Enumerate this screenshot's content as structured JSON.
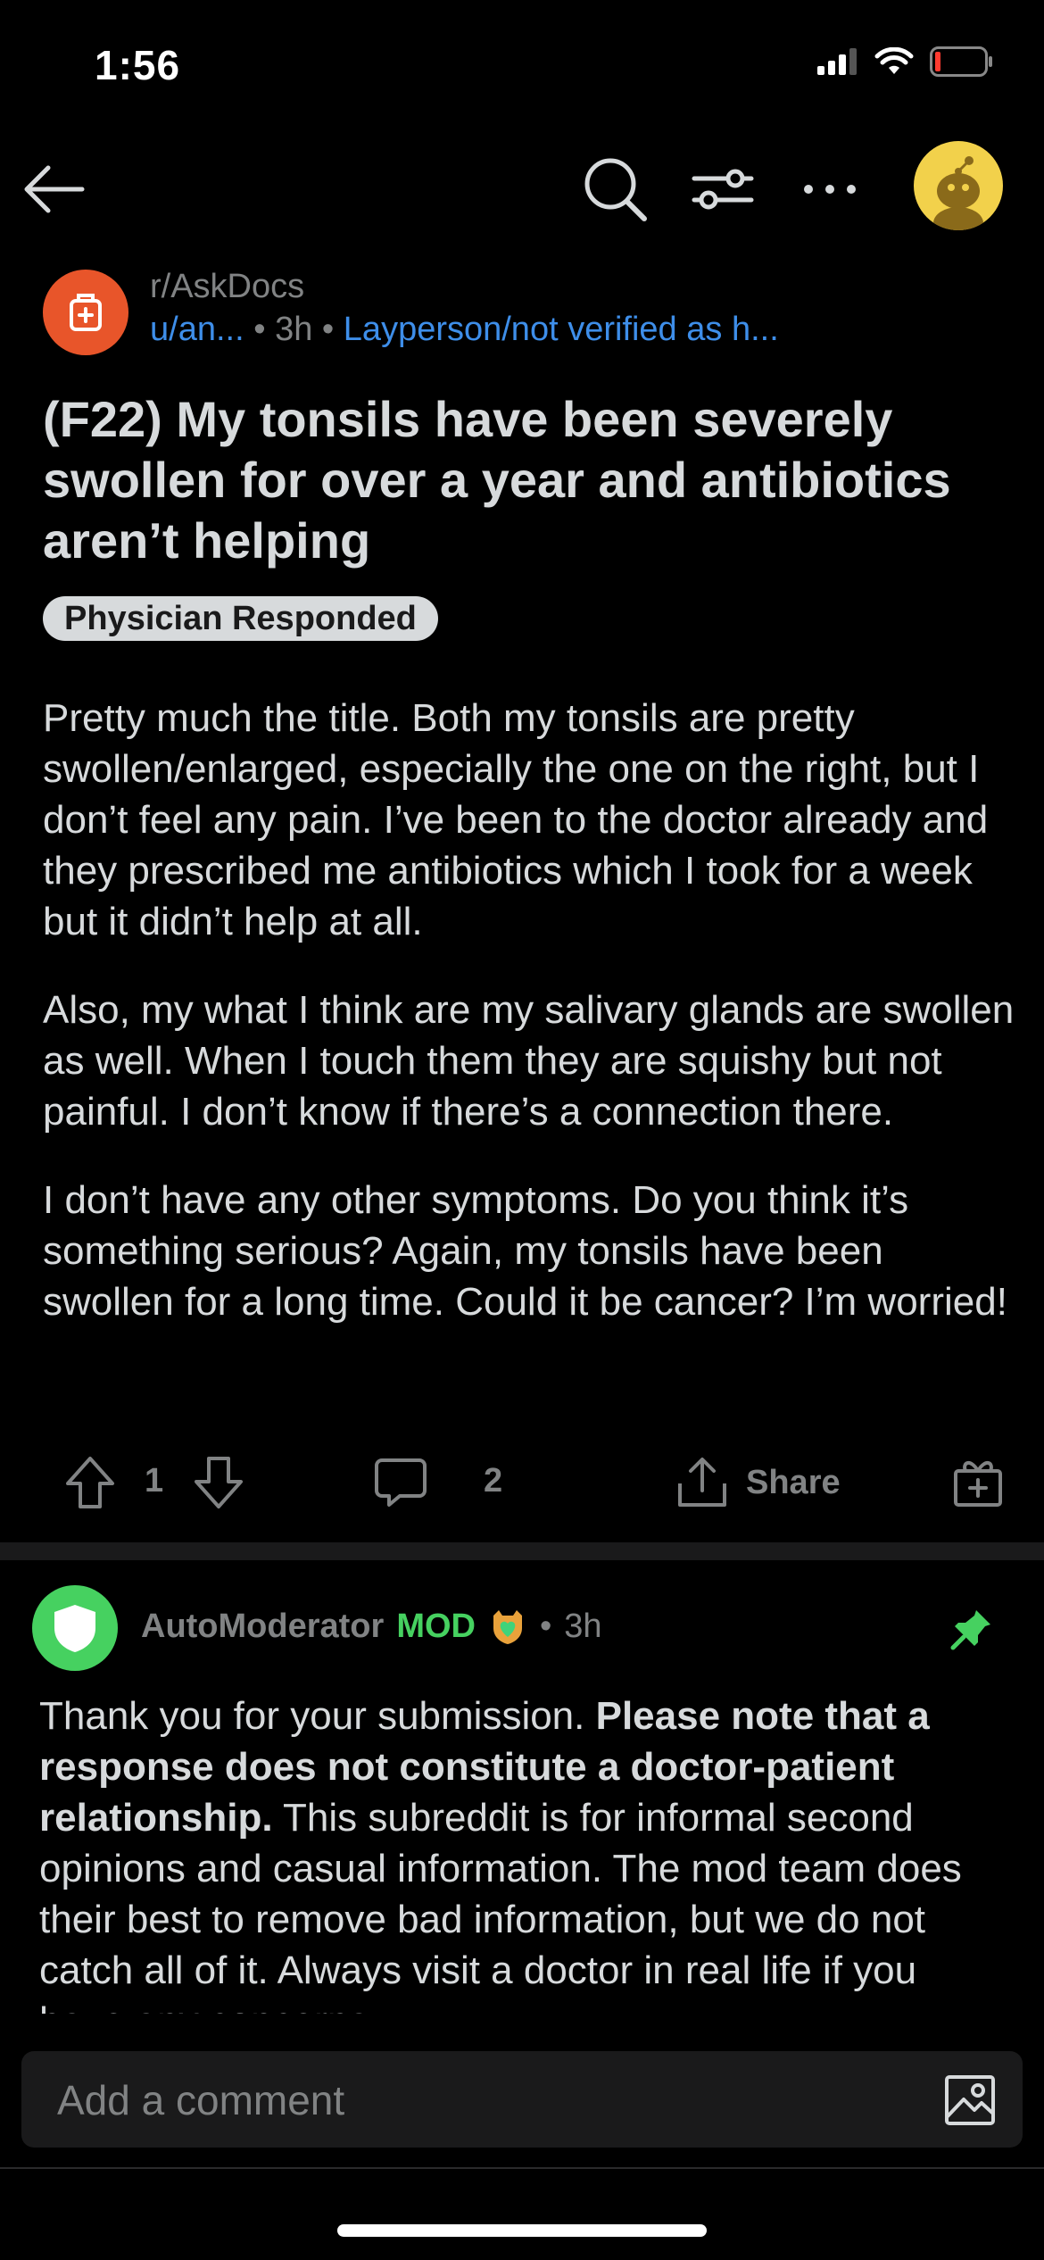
{
  "status_bar": {
    "time": "1:56",
    "icons": [
      "signal-icon",
      "wifi-icon",
      "battery-icon"
    ]
  },
  "nav": {
    "icons": [
      "back-arrow-icon",
      "search-icon",
      "filter-icon",
      "more-icon",
      "avatar"
    ]
  },
  "post": {
    "subreddit": "r/AskDocs",
    "author": "u/an...",
    "age": "3h",
    "author_flair": "Layperson/not verified as h...",
    "title": "(F22) My tonsils have been severely swollen for over a year and antibiotics aren’t helping",
    "flair": "Physician Responded",
    "body": [
      "Pretty much the title. Both my tonsils are pretty swollen/enlarged, especially the one on the right, but I don’t feel any pain. I’ve been to the doctor already and they prescribed me antibiotics which I took for a week but it didn’t help at all.",
      "Also, my what I think are my salivary glands are swollen as well. When I touch them they are squishy but not painful. I don’t know if there’s a connection there.",
      "I don’t have any other symptoms. Do you think it’s something serious? Again, my tonsils have been swollen for a long time. Could it be cancer? I’m worried!"
    ],
    "votes": "1",
    "comments": "2",
    "share_label": "Share"
  },
  "comment": {
    "author": "AutoModerator",
    "mod_badge": "MOD",
    "age": "3h",
    "body_intro": "Thank you for your submission. ",
    "body_bold": "Please note that a response does not constitute a doctor-patient relationship.",
    "body_rest": " This subreddit is for informal second opinions and casual information. The mod team does their best to remove bad information, but we do not catch all of it. Always visit a doctor in real life if you have any concerns."
  },
  "composer": {
    "placeholder": "Add a comment"
  },
  "colors": {
    "background": "#000000",
    "text": "#d7dadc",
    "muted": "#818384",
    "link_blue": "#3e8ee9",
    "mod_green": "#46d160",
    "subreddit_orange": "#e8552a",
    "avatar_yellow": "#f2d14b"
  }
}
